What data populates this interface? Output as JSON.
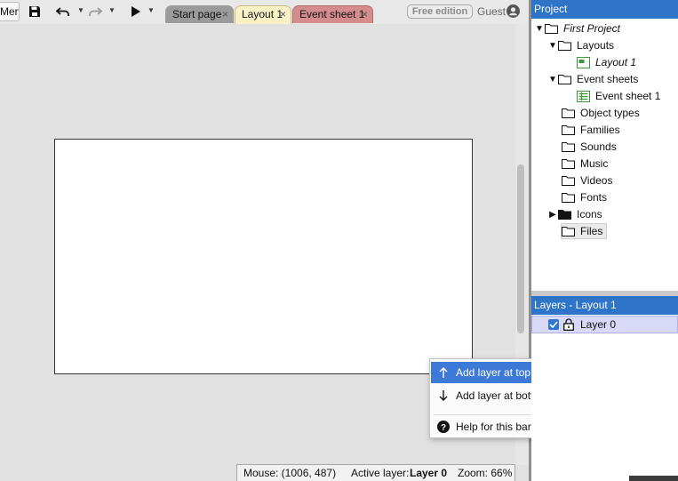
{
  "toolbar": {
    "menu_label": "Menu",
    "icons": [
      "save-icon",
      "undo-icon",
      "redo-icon",
      "play-icon"
    ],
    "tabs": [
      {
        "label": "Start page",
        "close": "×"
      },
      {
        "label": "Layout 1",
        "close": "×"
      },
      {
        "label": "Event sheet 1",
        "close": "×"
      }
    ],
    "edition_badge": "Free edition",
    "user_label": "Guest"
  },
  "status_bar": {
    "mouse_label": "Mouse: (1006, 487)",
    "active_layer_label": "Active layer:",
    "active_layer_value": "Layer 0",
    "zoom_label": "Zoom: 66%"
  },
  "context_menu": {
    "items": [
      {
        "label": "Add layer at top",
        "icon": "arrow-up-icon"
      },
      {
        "label": "Add layer at bottom",
        "icon": "arrow-down-icon"
      },
      {
        "label": "Help for this bar",
        "icon": "help-icon"
      }
    ]
  },
  "project_panel": {
    "title": "Project",
    "items": [
      {
        "label": "First Project",
        "icon": "folder-icon"
      },
      {
        "label": "Layouts",
        "icon": "folder-icon"
      },
      {
        "label": "Layout 1",
        "icon": "layout-icon"
      },
      {
        "label": "Event sheets",
        "icon": "folder-icon"
      },
      {
        "label": "Event sheet 1",
        "icon": "event-sheet-icon"
      },
      {
        "label": "Object types",
        "icon": "folder-icon"
      },
      {
        "label": "Families",
        "icon": "folder-icon"
      },
      {
        "label": "Sounds",
        "icon": "folder-icon"
      },
      {
        "label": "Music",
        "icon": "folder-icon"
      },
      {
        "label": "Videos",
        "icon": "folder-icon"
      },
      {
        "label": "Fonts",
        "icon": "folder-icon"
      },
      {
        "label": "Icons",
        "icon": "folder-filled-icon"
      },
      {
        "label": "Files",
        "icon": "folder-icon"
      }
    ]
  },
  "layers_panel": {
    "title": "Layers - Layout 1",
    "layers": [
      {
        "label": "Layer 0",
        "visible": true,
        "locked": false
      }
    ]
  },
  "colors": {
    "panel_header": "#2e74c9",
    "menu_highlight": "#3d7ad8",
    "layer_row": "#d8d9f7",
    "tab_layout": "#fbf1c7",
    "tab_event_sheet": "#d58c8c"
  }
}
